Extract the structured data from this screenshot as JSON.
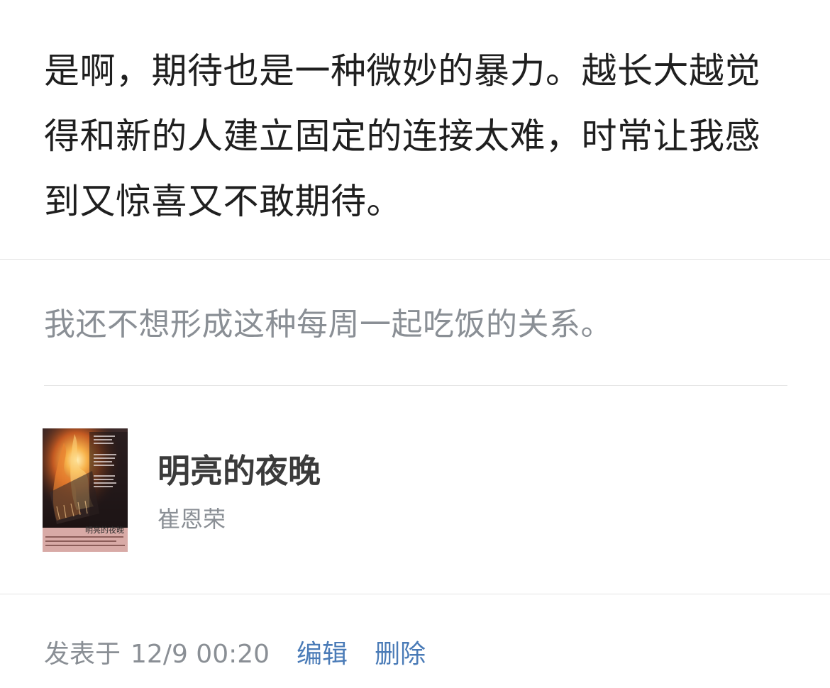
{
  "note": {
    "text": "是啊，期待也是一种微妙的暴力。越长大越觉得和新的人建立固定的连接太难，时常让我感到又惊喜又不敢期待。"
  },
  "quote": {
    "text": "我还不想形成这种每周一起吃饭的关系。"
  },
  "book": {
    "title": "明亮的夜晚",
    "author": "崔恩荣",
    "cover_title": "明亮的夜晚"
  },
  "footer": {
    "posted_prefix": "发表于",
    "posted_time": "12/9 00:20",
    "edit_label": "编辑",
    "delete_label": "删除"
  },
  "colors": {
    "body_text": "#1f1f1f",
    "quote_text": "#8a8f95",
    "link": "#4a7bb7",
    "divider": "#e3e3e3"
  }
}
